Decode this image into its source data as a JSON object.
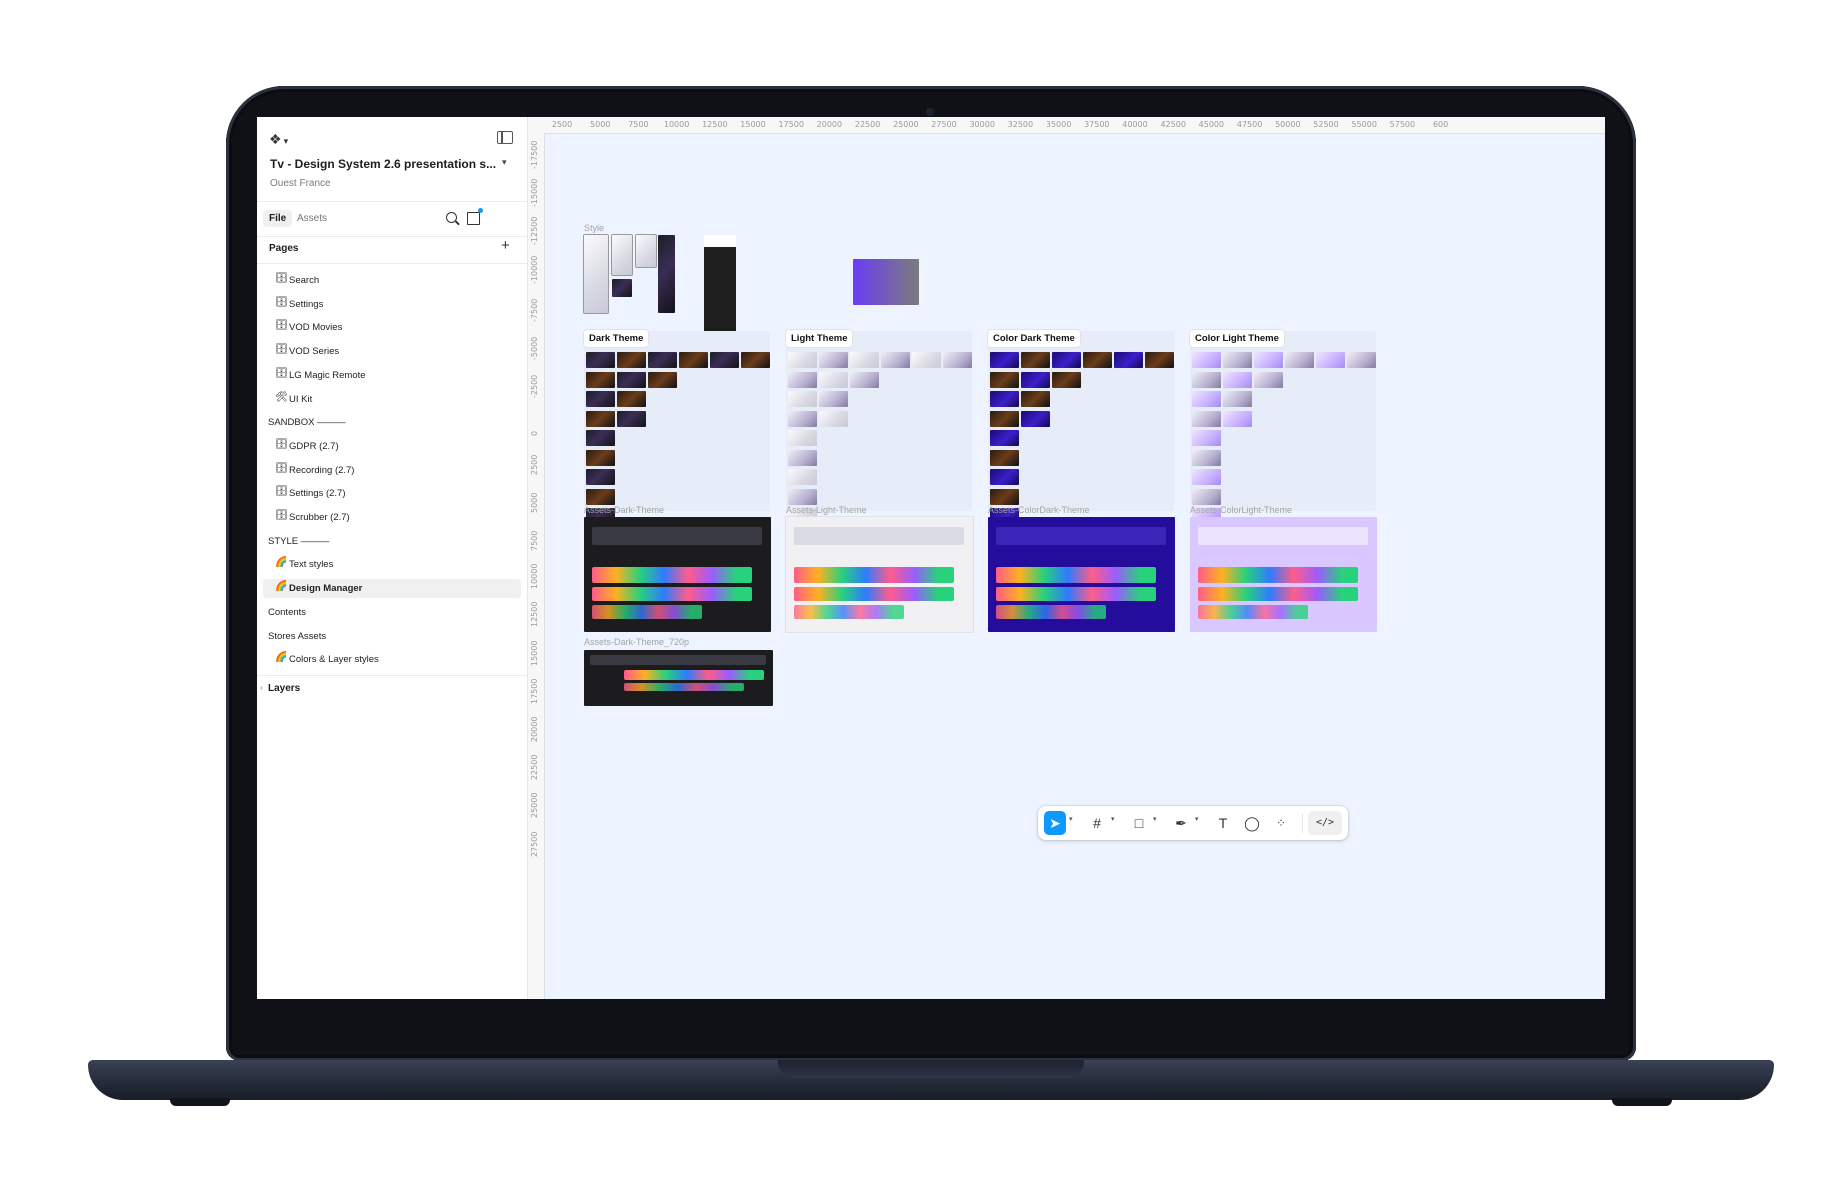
{
  "file": {
    "title": "Tv - Design System 2.6 presentation s...",
    "team": "Ouest France"
  },
  "sidebar": {
    "tabs": [
      "File",
      "Assets"
    ],
    "pages_header": "Pages",
    "pages": [
      {
        "icon": "🗄",
        "label": "Search"
      },
      {
        "icon": "🗄",
        "label": "Settings"
      },
      {
        "icon": "🗄",
        "label": "VOD Movies"
      },
      {
        "icon": "🗄",
        "label": "VOD Series"
      },
      {
        "icon": "🗄",
        "label": "LG Magic Remote"
      },
      {
        "icon": "🛠",
        "label": "UI Kit"
      }
    ],
    "sandbox_label": "SANDBOX ———",
    "sandbox_pages": [
      {
        "icon": "🗄",
        "label": "GDPR (2.7)"
      },
      {
        "icon": "🗄",
        "label": "Recording (2.7)"
      },
      {
        "icon": "🗄",
        "label": "Settings (2.7)"
      },
      {
        "icon": "🗄",
        "label": "Scrubber (2.7)"
      }
    ],
    "style_label": "STYLE ———",
    "style_pages": [
      {
        "icon": "🌈",
        "label": "Text styles"
      },
      {
        "icon": "🌈",
        "label": "Design Manager"
      }
    ],
    "contents_label": "Contents",
    "stores_label": "Stores Assets",
    "stores_pages": [
      {
        "icon": "🌈",
        "label": "Colors & Layer styles"
      }
    ],
    "layers_label": "Layers"
  },
  "ruler": {
    "top": [
      "2500",
      "5000",
      "7500",
      "10000",
      "12500",
      "15000",
      "17500",
      "20000",
      "22500",
      "25000",
      "27500",
      "30000",
      "32500",
      "35000",
      "37500",
      "40000",
      "42500",
      "45000",
      "47500",
      "50000",
      "52500",
      "55000",
      "57500",
      "600"
    ],
    "left": [
      "-17500",
      "-15000",
      "-12500",
      "-10000",
      "-7500",
      "-5000",
      "-2500",
      "0",
      "2500",
      "5000",
      "7500",
      "10000",
      "12500",
      "15000",
      "17500",
      "20000",
      "22500",
      "25000",
      "27500"
    ]
  },
  "canvas": {
    "style_frame_label": "Style",
    "sections": [
      "Dark Theme",
      "Light Theme",
      "Color Dark Theme",
      "Color Light Theme"
    ],
    "asset_labels": [
      "Assets-Dark-Theme",
      "Assets-Light-Theme",
      "Assets-ColorDark-Theme",
      "Assets-ColorLight-Theme"
    ],
    "asset_720_label": "Assets-Dark-Theme_720p"
  },
  "toolbar": {
    "tools": [
      "move-tool",
      "frame-tool",
      "shape-tool",
      "pen-tool",
      "text-tool",
      "comment-tool",
      "actions-tool"
    ],
    "dev_mode_label": "</>",
    "active_tool": "move-tool"
  },
  "colors": {
    "accent": "#0d99ff",
    "canvas_bg": "#eef4ff",
    "dark_theme": "#1c1c1f",
    "color_dark_theme": "#230d9a",
    "color_light_theme": "#d8c8ff"
  }
}
